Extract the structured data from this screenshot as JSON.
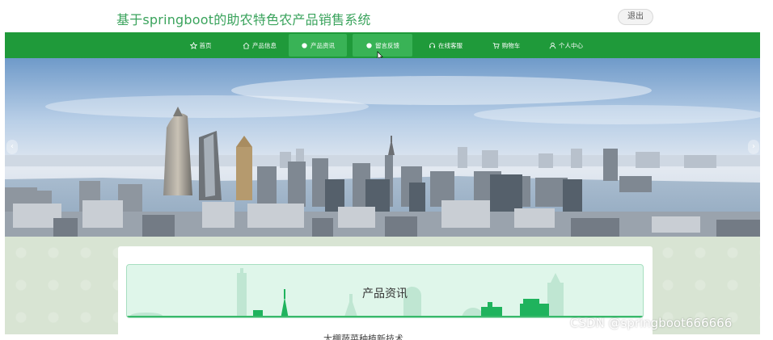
{
  "header": {
    "title": "基于springboot的助农特色农产品销售系统",
    "logout_label": "退出"
  },
  "nav": {
    "items": [
      {
        "label": "首页",
        "icon": "star-icon"
      },
      {
        "label": "产品信息",
        "icon": "home-icon"
      },
      {
        "label": "产品资讯",
        "icon": "dot-icon",
        "active": true
      },
      {
        "label": "留言反馈",
        "icon": "dot-icon",
        "active": true
      },
      {
        "label": "在线客服",
        "icon": "headset-icon"
      },
      {
        "label": "购物车",
        "icon": "cart-icon"
      },
      {
        "label": "个人中心",
        "icon": "user-icon"
      }
    ]
  },
  "carousel": {
    "prev_icon": "chevron-left-icon",
    "next_icon": "chevron-right-icon",
    "prev_symbol": "‹",
    "next_symbol": "›"
  },
  "news_section": {
    "title": "产品资讯",
    "partial_item_text": "大棚蔬菜种植新技术"
  },
  "watermark": "CSDN @springboot666666",
  "colors": {
    "brand_green": "#1f9a3a",
    "active_green": "#39b356",
    "title_green": "#3aa35c",
    "section_bg": "#dff6ea"
  }
}
